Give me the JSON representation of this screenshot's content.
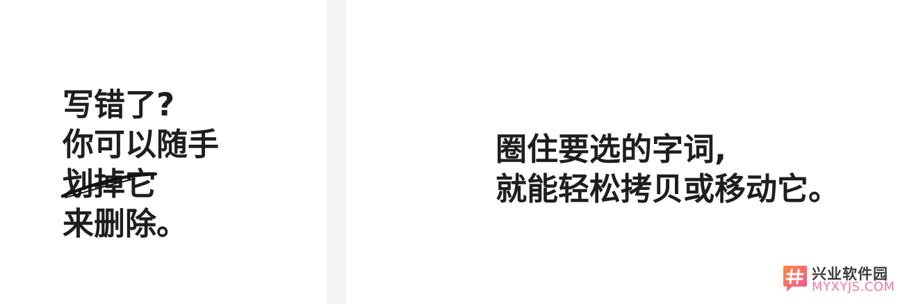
{
  "left_panel": {
    "lines": [
      "写错了?",
      "你可以随手",
      "划掉",
      "它",
      "来删除。"
    ]
  },
  "right_panel": {
    "lines": [
      "圈住要选的字词,",
      "就能轻松拷贝或移动它。"
    ]
  },
  "watermark": {
    "title": "兴业软件园",
    "url": "MYXYJS.COM",
    "logo_icon": "hash-icon",
    "colors": {
      "gradient_start": "#ff8a3d",
      "gradient_end": "#f0559c"
    }
  }
}
